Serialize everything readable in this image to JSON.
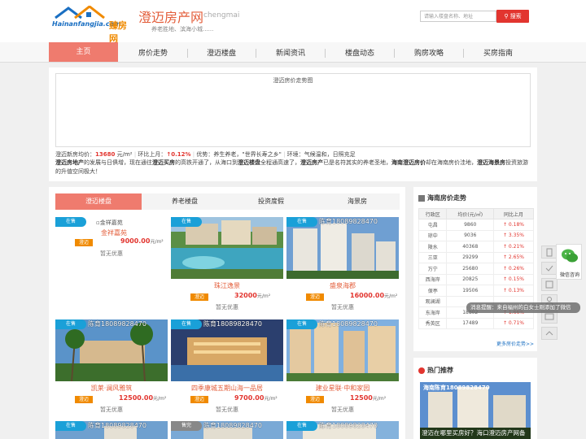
{
  "header": {
    "logo_text": "Hainanfangjia.com",
    "logo_sub": "臻房网",
    "site_title": "澄迈房产网",
    "site_en": "chengmai",
    "slogan": "养老胜地、滨海小城......",
    "search_placeholder": "请输入楼盘名称、地址",
    "search_button": "搜索"
  },
  "nav": {
    "items": [
      "主页",
      "房价走势",
      "澄迈楼盘",
      "新闻资讯",
      "楼盘动态",
      "购房攻略",
      "买房指南"
    ],
    "active_index": 0
  },
  "trend": {
    "chart_title": "澄迈房价走势图",
    "stats": {
      "avg_label": "澄迈新房均价：",
      "avg_value": "13680",
      "avg_unit": "元/m²",
      "mom_label": "环比上月：",
      "mom_value": "↑0.12%",
      "advantage": "优势：养生养老，\"世界长寿之乡\"",
      "env": "环境：气候温和，日照充足"
    },
    "intro": {
      "p1": "澄迈房地产",
      "p2": "的发展与日俱增，现在通往",
      "p3": "澄迈买房",
      "p4": "的高铁开通了，从海口到",
      "p5": "澄迈楼盘",
      "p6": "全程通高速了，",
      "p7": "澄迈房产",
      "p8": "已是名符其实的养老圣地，",
      "p9": "海南澄迈房价",
      "p10": "却在海南房价洼地，",
      "p11": "澄迈海景房",
      "p12": "投资旅游的升值空间极大！"
    }
  },
  "listings": {
    "tabs": [
      "澄迈楼盘",
      "养老楼盘",
      "投资度假",
      "海景房"
    ],
    "active_tab": 0,
    "cards": [
      {
        "badge": "在售",
        "alt": "金祥嘉苑",
        "name": "金祥嘉苑",
        "region": "澄迈",
        "price": "9000.00",
        "unit": "元/m²",
        "promo": "暂无优惠",
        "watermark": "",
        "image": "none"
      },
      {
        "badge": "在售",
        "alt": "",
        "name": "珠江逸景",
        "region": "澄迈",
        "price": "32000",
        "unit": "元/m²",
        "promo": "暂无优惠",
        "watermark": "",
        "image": "resort"
      },
      {
        "badge": "在售",
        "alt": "",
        "name": "盛泉海郡",
        "region": "澄迈",
        "price": "16000.00",
        "unit": "元/m²",
        "promo": "暂无优惠",
        "watermark": "陈育18089828470",
        "image": "towers"
      },
      {
        "badge": "在售",
        "alt": "",
        "name": "凯莱·澜风雅筑",
        "region": "澄迈",
        "price": "12500.00",
        "unit": "元/m²",
        "promo": "暂无优惠",
        "watermark": "陈育18089828470",
        "image": "palms"
      },
      {
        "badge": "在售",
        "alt": "",
        "name": "四季康城五期山海一品居",
        "region": "澄迈",
        "price": "9700.00",
        "unit": "元/m²",
        "promo": "暂无优惠",
        "watermark": "陈育18089828470",
        "image": "night"
      },
      {
        "badge": "在售",
        "alt": "",
        "name": "建业星联·中和家园",
        "region": "澄迈",
        "price": "12500",
        "unit": "元/m²",
        "promo": "暂无优惠",
        "watermark": "陈育18089828470",
        "image": "blocks"
      },
      {
        "badge": "在售",
        "alt": "",
        "name": "",
        "region": "",
        "price": "",
        "unit": "",
        "promo": "",
        "watermark": "陈育18089828470",
        "image": "partial"
      },
      {
        "badge": "售完",
        "alt": "",
        "name": "",
        "region": "",
        "price": "",
        "unit": "",
        "promo": "",
        "watermark": "陈育18089828470",
        "image": "partial"
      },
      {
        "badge": "在售",
        "alt": "",
        "name": "",
        "region": "",
        "price": "",
        "unit": "",
        "promo": "",
        "watermark": "陈育18089828470",
        "image": "partial"
      }
    ]
  },
  "price_table": {
    "title": "海南房价走势",
    "headers": [
      "行政区",
      "均价(元/㎡)",
      "同比上月"
    ],
    "rows": [
      [
        "屯昌",
        "9860",
        "↑ 0.18%"
      ],
      [
        "琼中",
        "9036",
        "↑ 3.35%"
      ],
      [
        "陵水",
        "40368",
        "↑ 0.21%"
      ],
      [
        "三亚",
        "29299",
        "↑ 2.65%"
      ],
      [
        "万宁",
        "25680",
        "↑ 0.26%"
      ],
      [
        "西海岸",
        "20825",
        "↑ 0.15%"
      ],
      [
        "保亭",
        "19506",
        "↑ 0.13%"
      ],
      [
        "观澜湖",
        "",
        ""
      ],
      [
        "东海岸",
        "18802",
        "↑ 1.66%"
      ],
      [
        "秀英区",
        "17489",
        "↑ 0.71%"
      ]
    ],
    "more": "更多房价走势>>"
  },
  "hot": {
    "title": "热门推荐",
    "watermark": "海南陈育18089828470",
    "caption": "澄迈在哪里买房好？海口澄迈房产网备"
  },
  "wechat": {
    "label": "微信咨询"
  },
  "toast": "消息提醒：来自福州的白女士刚添加了微信",
  "colors": {
    "accent": "#ef7b6e",
    "red": "#e2352f",
    "blue_badge": "#1aa0d8",
    "orange": "#f08a00"
  }
}
